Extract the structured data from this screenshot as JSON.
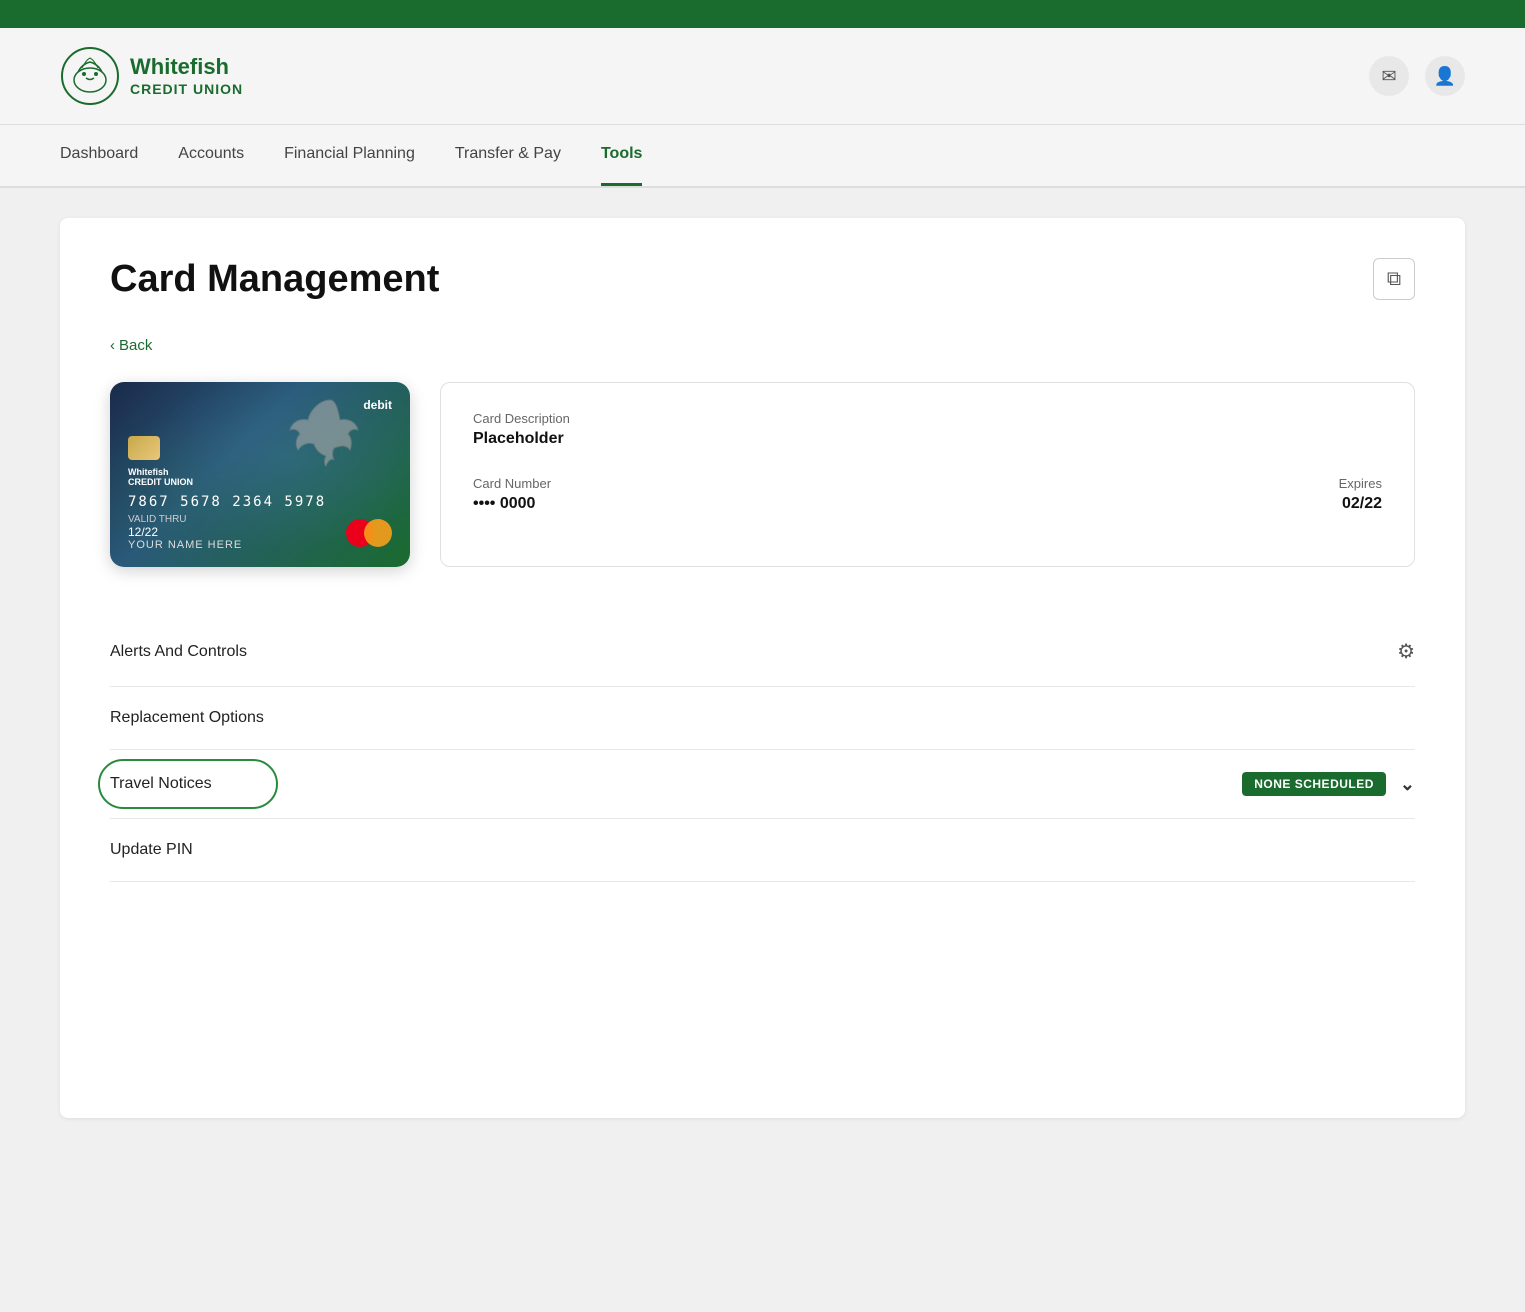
{
  "topBar": {},
  "header": {
    "logoLine1": "Whitefish",
    "logoLine2": "CREDIT UNION",
    "mailIconLabel": "✉",
    "userIconLabel": "👤"
  },
  "nav": {
    "items": [
      {
        "label": "Dashboard",
        "active": false
      },
      {
        "label": "Accounts",
        "active": false
      },
      {
        "label": "Financial Planning",
        "active": false
      },
      {
        "label": "Transfer & Pay",
        "active": false
      },
      {
        "label": "Tools",
        "active": true
      }
    ]
  },
  "page": {
    "title": "Card Management",
    "backLabel": "Back",
    "card": {
      "debitLabel": "debit",
      "number": "7867  5678  2364  5978",
      "maskedNumber": "•••• 0000",
      "validThru": "12/22",
      "cardholderName": "YOUR NAME HERE",
      "logoLine1": "Whitefish",
      "logoLine2": "CREDIT UNION"
    },
    "cardInfo": {
      "descriptionLabel": "Card Description",
      "descriptionValue": "Placeholder",
      "numberLabel": "Card Number",
      "numberValue": "•••• 0000",
      "expiresLabel": "Expires",
      "expiresValue": "02/22"
    },
    "sections": [
      {
        "label": "Alerts And Controls",
        "rightType": "gear",
        "badgeText": null
      },
      {
        "label": "Replacement Options",
        "rightType": "none",
        "badgeText": null
      },
      {
        "label": "Travel Notices",
        "rightType": "badge-chevron",
        "badgeText": "NONE SCHEDULED",
        "highlighted": true
      },
      {
        "label": "Update PIN",
        "rightType": "none",
        "badgeText": null
      }
    ]
  }
}
